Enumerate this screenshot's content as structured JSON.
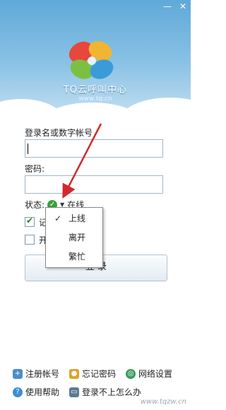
{
  "window": {
    "minimize_label": "—",
    "close_label": "✕"
  },
  "brand": {
    "name": "TQ云呼叫中心",
    "url": "www.tq.cn"
  },
  "form": {
    "account_label": "登录名或数字帐号",
    "account_value": "",
    "password_label": "密码:",
    "password_value": "",
    "status_label": "状态:",
    "status_value": "在线",
    "remember_label": "记",
    "remember_checked": true,
    "autologin_label": "开",
    "autologin_checked": false,
    "login_button": "登  录"
  },
  "status_menu": {
    "items": [
      {
        "label": "上线",
        "checked": true
      },
      {
        "label": "离开",
        "checked": false
      },
      {
        "label": "繁忙",
        "checked": false
      }
    ]
  },
  "footer": {
    "register": "注册帐号",
    "forgot": "忘记密码",
    "network": "网络设置",
    "help": "使用帮助",
    "cannot_login": "登录不上怎么办"
  },
  "watermark": "www.tqzw.cn",
  "colors": {
    "sky_top": "#5fa9d8",
    "status_green": "#3aa33a",
    "annotation_red": "#d22a2a"
  }
}
